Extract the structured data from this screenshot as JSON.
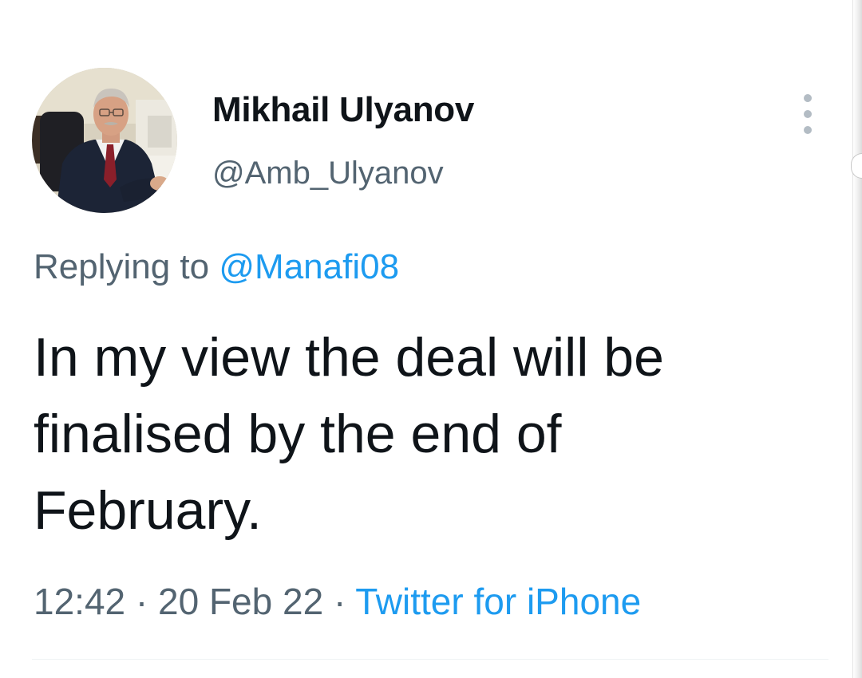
{
  "tweet": {
    "author": {
      "display_name": "Mikhail Ulyanov",
      "handle": "@Amb_Ulyanov",
      "avatar_icon": "profile-photo"
    },
    "more_icon": "more-vertical-icon",
    "reply": {
      "prefix": "Replying to",
      "mention": "@Manafi08"
    },
    "text_lines": [
      "In my view the deal will be",
      "finalised by the end of",
      "February."
    ],
    "meta": {
      "time": "12:42",
      "separator": "·",
      "date": "20 Feb 22",
      "source": "Twitter for iPhone"
    }
  },
  "colors": {
    "text_primary": "#0f1419",
    "text_secondary": "#536471",
    "link_blue": "#1d9bf0"
  }
}
